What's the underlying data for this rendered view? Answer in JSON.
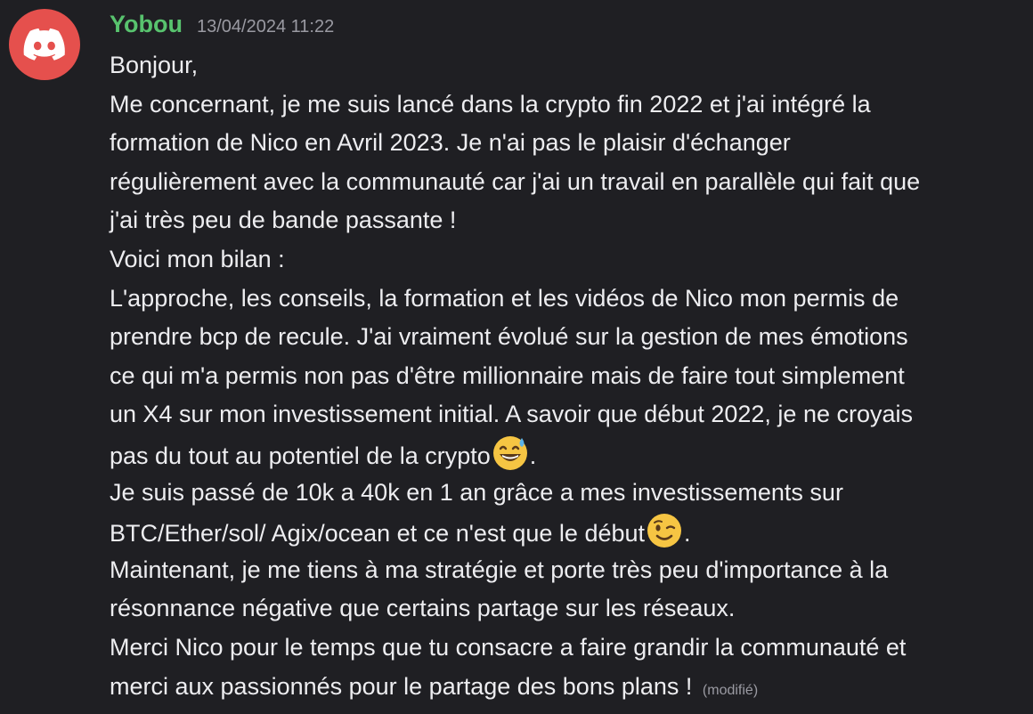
{
  "message": {
    "username": "Yobou",
    "timestamp": "13/04/2024 11:22",
    "edited_label": "(modifié)",
    "avatar_icon": "discord-logo-icon",
    "colors": {
      "background": "#1f1f23",
      "username": "#58c36e",
      "avatar_bg": "#e5504d",
      "text": "#ededf0",
      "muted": "#9a9aa2"
    },
    "lines": [
      "Bonjour,",
      "Me concernant, je me suis lancé dans la crypto fin 2022 et j'ai intégré la",
      "formation de Nico en Avril 2023. Je n'ai pas le plaisir d'échanger",
      "régulièrement avec la communauté car j'ai un travail en parallèle qui fait que",
      "j'ai très peu de bande passante !",
      "Voici mon bilan :",
      "L'approche, les conseils, la formation et les vidéos de Nico mon permis de",
      "prendre bcp de recule. J'ai vraiment évolué sur la gestion de mes émotions",
      "ce qui m'a permis non pas d'être millionnaire mais de faire tout simplement",
      "un X4 sur mon investissement initial. A savoir que début 2022, je ne croyais",
      "pas du tout au potentiel de la crypto",
      ".",
      "Je suis passé de 10k a 40k en 1 an grâce a mes investissements sur",
      "BTC/Ether/sol/ Agix/ocean et ce n'est que le début",
      ".",
      "Maintenant, je me tiens à ma stratégie et porte très peu d'importance à la",
      "résonnance négative que certains partage sur les réseaux.",
      "Merci Nico pour le temps que tu consacre a faire grandir la communauté et",
      "merci aux passionnés pour le partage des bons plans !"
    ],
    "emojis": {
      "sweat_smile": "grinning-sweat-emoji-icon",
      "wink": "winking-face-emoji-icon"
    }
  }
}
